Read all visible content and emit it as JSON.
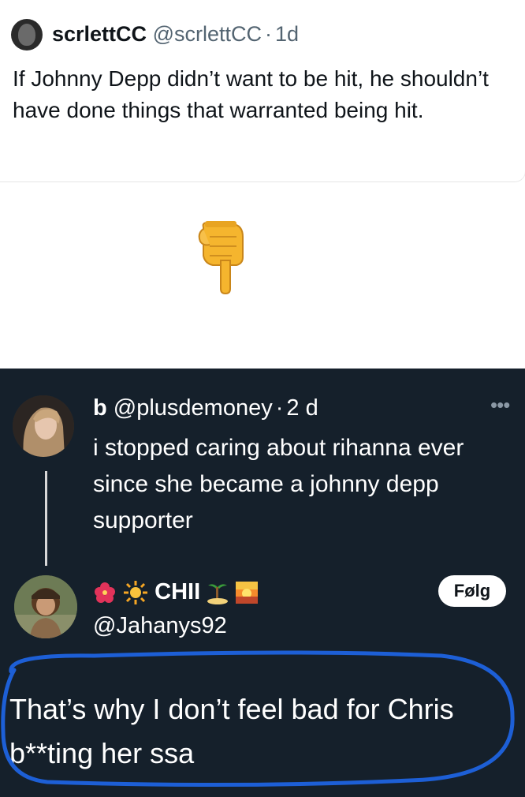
{
  "top_tweet": {
    "display_name": "scrlettCC",
    "handle": "@scrlettCC",
    "separator": "·",
    "time": "1d",
    "text": "If Johnny Depp didn’t want to be hit, he shouldn’t have done things that warranted being hit.",
    "avatar_icon": "avatar-icon"
  },
  "pointer": {
    "icon": "pointing-down-icon",
    "color": "#f2b12d"
  },
  "dark_card": {
    "background": "#15202b",
    "annotation_color": "#1d5fd6",
    "quoted_tweet": {
      "display_name": "b",
      "handle": "@plusdemoney",
      "separator": "·",
      "time": "2 d",
      "text": "i stopped caring about rihanna ever since she became a johnny depp supporter",
      "more_icon": "more-options-icon",
      "more_label": "•••"
    },
    "reply": {
      "display_name": "CHII",
      "handle": "@Jahanys92",
      "follow_label": "Følg",
      "name_icons": [
        "hibiscus-icon",
        "sun-icon",
        "island-icon",
        "sunset-icon"
      ],
      "text": "That’s why I don’t feel bad for Chris b**ting her ssa"
    }
  }
}
